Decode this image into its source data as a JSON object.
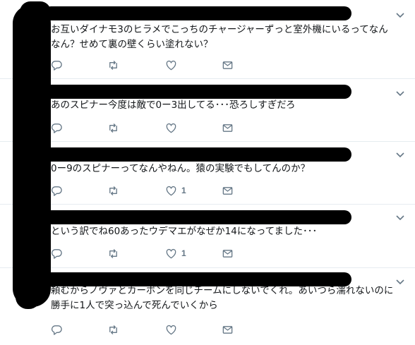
{
  "tweets": [
    {
      "text": "お互いダイナモ3のヒラメでこっちのチャージャーずっと室外機にいるってなん\nなん？せめて裏の壁くらい塗れない？",
      "actions": {
        "reply_count": "",
        "retweet_count": "",
        "like_count": ""
      }
    },
    {
      "text": "あのスピナー今度は敵で0ー3出してる･･･恐ろしすぎだろ",
      "actions": {
        "reply_count": "",
        "retweet_count": "",
        "like_count": ""
      }
    },
    {
      "text": "0ー9のスピナーってなんやねん。猿の実験でもしてんのか？",
      "actions": {
        "reply_count": "",
        "retweet_count": "",
        "like_count": "1"
      }
    },
    {
      "text": "という訳でね60あったウデマエがなぜか14になってました･･･",
      "actions": {
        "reply_count": "",
        "retweet_count": "",
        "like_count": "1"
      }
    },
    {
      "text": "頼むからノヴァとカーボンを同じチームにしないでくれ。あいつら濡れないのに\n勝手に1人で突っ込んで死んでいくから",
      "actions": {
        "reply_count": "",
        "retweet_count": "",
        "like_count": ""
      }
    }
  ],
  "icons": {
    "reply": "reply-icon",
    "retweet": "retweet-icon",
    "like": "heart-icon",
    "message": "envelope-icon",
    "more": "chevron-down-icon"
  },
  "colors": {
    "icon": "#657786",
    "text": "#14171a",
    "divider": "#e6ecf0"
  }
}
